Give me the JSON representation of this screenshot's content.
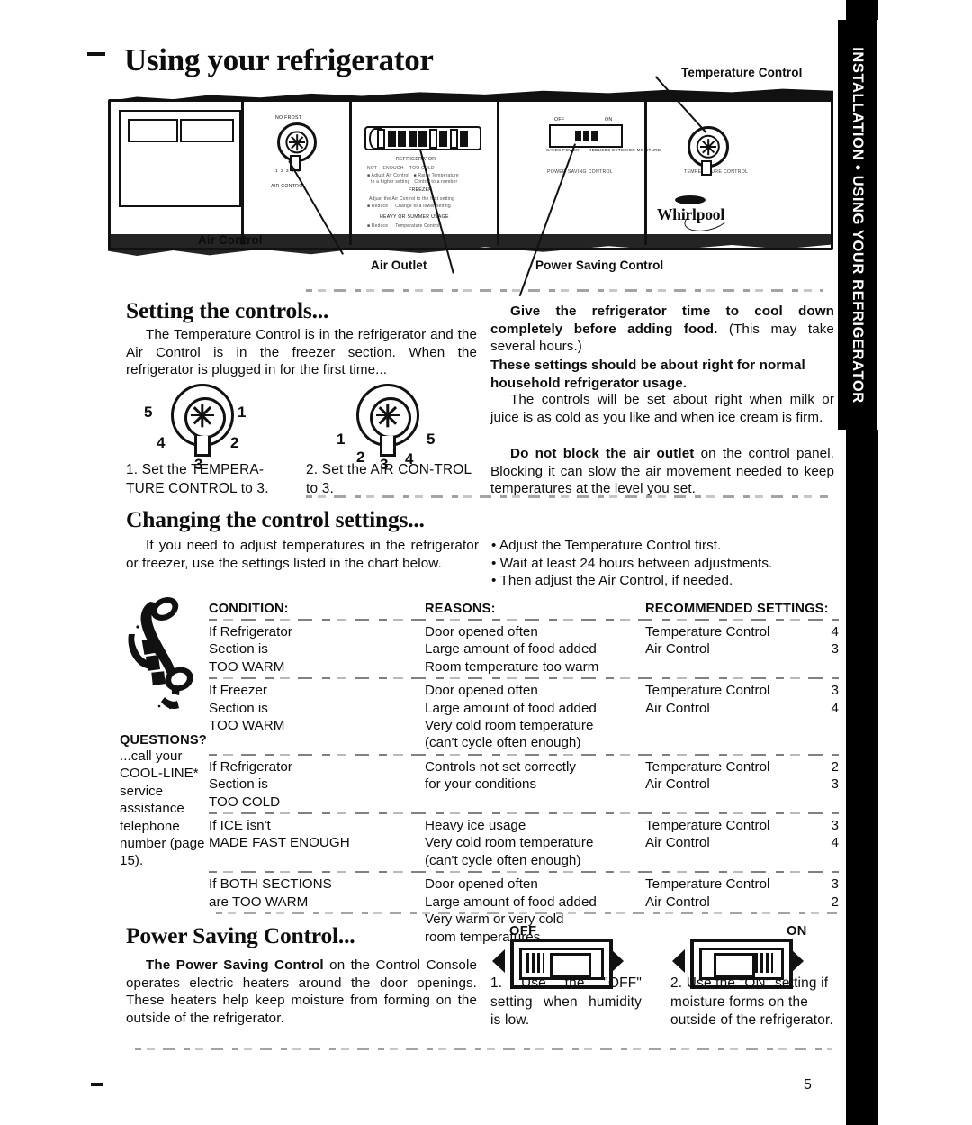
{
  "page": {
    "title": "Using your refrigerator",
    "page_number": "5",
    "thumb_tab": "INSTALLATION • USING YOUR REFRIGERATOR"
  },
  "illustration": {
    "callouts": [
      {
        "name": "temperature-control",
        "label": "Temperature Control"
      },
      {
        "name": "air-control",
        "label": "Air Control"
      },
      {
        "name": "air-outlet",
        "label": "Air Outlet"
      },
      {
        "name": "power-saving-control",
        "label": "Power Saving Control"
      }
    ],
    "panel_text": {
      "no_frost": "NO FROST",
      "air_control": "AIR CONTROL",
      "refrigerator": "REFRIGERATOR",
      "freezer": "FREEZER",
      "heavy_or_summer_usage": "HEAVY OR SUMMER USAGE",
      "off": "OFF",
      "on": "ON",
      "saves_power": "SAVES POWER",
      "reduces_exterior_moisture": "REDUCES EXTERIOR MOISTURE",
      "power_saving_control": "POWER SAVING CONTROL",
      "temperature_control": "TEMPERATURE CONTROL",
      "brand": "Whirlpool"
    }
  },
  "setting_the_controls": {
    "heading": "Setting the controls...",
    "intro": "The Temperature Control is in the refrigerator and the Air Control is in the freezer section. When the refrigerator is plugged in for the first time...",
    "dials": [
      {
        "name": "temperature-control-dial",
        "numbers": [
          "5",
          "1",
          "4",
          "2",
          "3"
        ],
        "step_number": "1.",
        "caption": "Set the TEMPERA-TURE CONTROL to 3."
      },
      {
        "name": "air-control-dial",
        "numbers": [
          "1",
          "5",
          "2",
          "3",
          "4"
        ],
        "step_number": "2.",
        "caption": "Set the AIR CON-TROL to 3."
      }
    ],
    "right_column": {
      "p1_bold": "Give the refrigerator time to cool down completely before adding food.",
      "p1_rest": "(This may take several hours.)",
      "p2_bold": "These settings should be about right for normal household refrigerator usage.",
      "p3": "The controls will be set about right when milk or juice is as cold as you like and when ice cream is firm.",
      "p4_bold": "Do not block the air outlet",
      "p4_rest": "on the control panel. Blocking it can slow the air movement needed to keep temperatures at the level you set."
    }
  },
  "changing_the_control_settings": {
    "heading": "Changing the control settings...",
    "intro": "If you need to adjust temperatures in the refrigerator or freezer, use the settings listed in the chart below.",
    "bullets": [
      "Adjust the Temperature Control first.",
      "Wait at least 24 hours between adjustments.",
      "Then adjust the Air Control, if needed."
    ]
  },
  "questions_box": {
    "title": "QUESTIONS?",
    "text": "...call your COOL-LINE* service assistance telephone number (page 15)."
  },
  "chart_data": {
    "type": "table",
    "title": "Changing the control settings chart",
    "columns": [
      "CONDITION:",
      "REASONS:",
      "RECOMMENDED SETTINGS:"
    ],
    "rows": [
      {
        "condition": [
          "If Refrigerator",
          "Section is",
          "TOO WARM"
        ],
        "reasons": [
          "Door opened often",
          "Large amount of food added",
          "Room temperature too warm"
        ],
        "settings": [
          {
            "control": "Temperature Control",
            "value": "4"
          },
          {
            "control": "Air Control",
            "value": "3"
          }
        ]
      },
      {
        "condition": [
          "If Freezer",
          "Section is",
          "TOO WARM"
        ],
        "reasons": [
          "Door opened often",
          "Large amount of food added",
          "Very cold room temperature",
          "(can't cycle often enough)"
        ],
        "settings": [
          {
            "control": "Temperature Control",
            "value": "3"
          },
          {
            "control": "Air Control",
            "value": "4"
          }
        ]
      },
      {
        "condition": [
          "If Refrigerator",
          "Section is",
          "TOO COLD"
        ],
        "reasons": [
          "Controls not set correctly",
          "for your conditions"
        ],
        "settings": [
          {
            "control": "Temperature Control",
            "value": "2"
          },
          {
            "control": "Air Control",
            "value": "3"
          }
        ]
      },
      {
        "condition": [
          "If ICE isn't",
          "MADE FAST ENOUGH"
        ],
        "reasons": [
          "Heavy ice usage",
          "Very cold room temperature",
          "(can't cycle often enough)"
        ],
        "settings": [
          {
            "control": "Temperature Control",
            "value": "3"
          },
          {
            "control": "Air Control",
            "value": "4"
          }
        ]
      },
      {
        "condition": [
          "If BOTH SECTIONS",
          "are TOO WARM"
        ],
        "reasons": [
          "Door opened often",
          "Large amount of food added",
          "Very warm or very cold",
          "room temperatures"
        ],
        "settings": [
          {
            "control": "Temperature Control",
            "value": "3"
          },
          {
            "control": "Air Control",
            "value": "2"
          }
        ]
      }
    ]
  },
  "power_saving_control": {
    "heading": "Power Saving Control...",
    "body_bold": "The Power Saving Control",
    "body_rest": "on the Control Console operates electric heaters around the door openings. These heaters help keep moisture from forming on the outside of the refrigerator.",
    "switches": [
      {
        "name": "off-switch",
        "state": "OFF",
        "step_number": "1.",
        "caption": "Use the \"OFF\" setting when humidity is low."
      },
      {
        "name": "on-switch",
        "state": "ON",
        "step_number": "2.",
        "caption": "Use the \"ON\" setting if moisture forms on the outside of the refrigerator."
      }
    ]
  }
}
